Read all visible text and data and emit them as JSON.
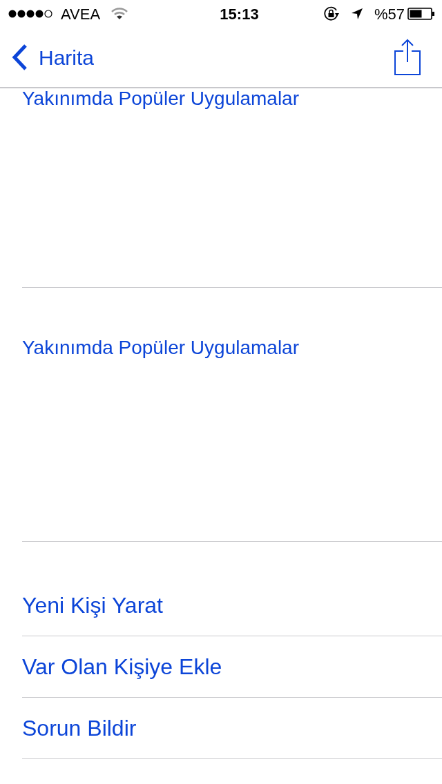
{
  "status_bar": {
    "carrier": "AVEA",
    "time": "15:13",
    "battery": "%57"
  },
  "nav_bar": {
    "back_label": "Harita"
  },
  "sections": [
    {
      "title": "Yakınımda Popüler Uygulamalar"
    },
    {
      "title": "Yakınımda Popüler Uygulamalar"
    }
  ],
  "actions": [
    {
      "label": "Yeni Kişi Yarat"
    },
    {
      "label": "Var Olan Kişiye Ekle"
    },
    {
      "label": "Sorun Bildir"
    }
  ]
}
